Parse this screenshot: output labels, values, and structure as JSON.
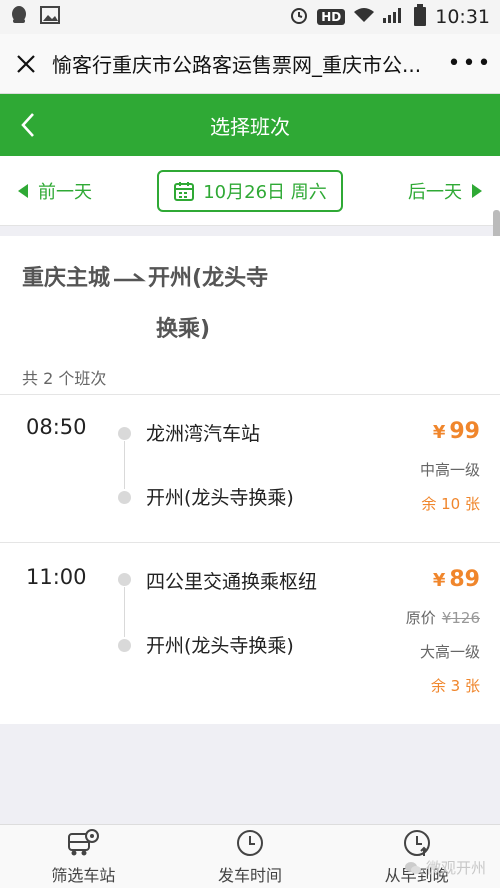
{
  "statusbar": {
    "hd": "HD",
    "time": "10:31"
  },
  "browser": {
    "title": "愉客行重庆市公路客运售票网_重庆市公...",
    "more": "•••"
  },
  "header": {
    "title": "选择班次"
  },
  "datebar": {
    "prev_label": "前一天",
    "date_label": "10月26日 周六",
    "next_label": "后一天"
  },
  "route": {
    "origin": "重庆主城",
    "dest_line1": "开州(龙头寺",
    "dest_line2": "换乘)",
    "count_label": "共 2 个班次"
  },
  "trips": [
    {
      "time": "08:50",
      "from": "龙洲湾汽车站",
      "to": "开州(龙头寺换乘)",
      "price": "99",
      "currency": "¥",
      "bus_class": "中高一级",
      "remain": "余 10 张"
    },
    {
      "time": "11:00",
      "from": "四公里交通换乘枢纽",
      "to": "开州(龙头寺换乘)",
      "price": "89",
      "currency": "¥",
      "original_price_label": "原价",
      "original_price": "¥126",
      "bus_class": "大高一级",
      "remain": "余 3 张"
    }
  ],
  "footer": {
    "items": [
      {
        "label": "筛选车站",
        "icon": "bus-filter-icon"
      },
      {
        "label": "发车时间",
        "icon": "clock-icon"
      },
      {
        "label": "从早到晚",
        "icon": "clock-up-icon"
      }
    ]
  },
  "watermark": {
    "text": "微观开州"
  },
  "colors": {
    "primary": "#2fa935",
    "price": "#f0862c"
  }
}
